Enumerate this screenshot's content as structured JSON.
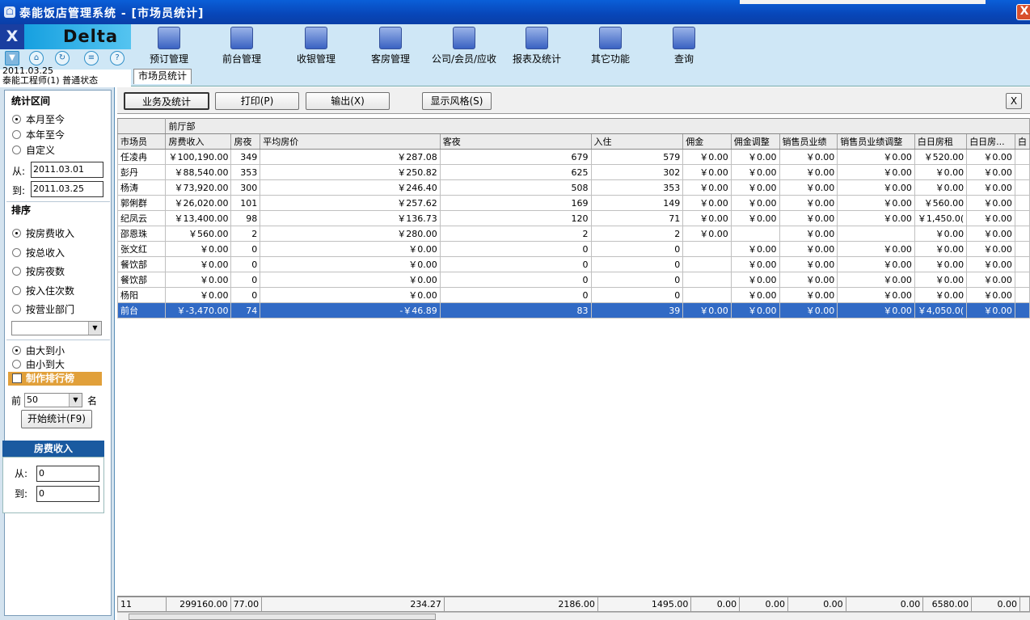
{
  "window": {
    "title": "泰能饭店管理系统 - [市场员统计]",
    "close_glyph": "X"
  },
  "logo": {
    "text": "Delta",
    "close_glyph": "X"
  },
  "toolbar": [
    {
      "label": "预订管理"
    },
    {
      "label": "前台管理"
    },
    {
      "label": "收银管理"
    },
    {
      "label": "客房管理"
    },
    {
      "label": "公司/会员/应收"
    },
    {
      "label": "报表及统计"
    },
    {
      "label": "其它功能"
    },
    {
      "label": "查询"
    }
  ],
  "status": {
    "date": "2011.03.25",
    "user": "泰能工程师(1) 普通状态"
  },
  "tab": {
    "label": "市场员统计"
  },
  "left": {
    "period_title": "统计区间",
    "period_options": [
      "本月至今",
      "本年至今",
      "自定义"
    ],
    "from_label": "从:",
    "from_value": "2011.03.01",
    "to_label": "到:",
    "to_value": "2011.03.25",
    "sort_title": "排序",
    "sort_options": [
      "按房费收入",
      "按总收入",
      "按房夜数",
      "按入住次数",
      "按营业部门"
    ],
    "dept_select": "",
    "order_options": [
      "由大到小",
      "由小到大"
    ],
    "rank_label": "制作排行榜",
    "top_label": "前",
    "top_value": "50",
    "top_suffix": "名",
    "start_button": "开始统计(F9)",
    "fee_title": "房费收入",
    "fee_from_label": "从:",
    "fee_from": "0",
    "fee_to_label": "到:",
    "fee_to": "0"
  },
  "actions": {
    "business": "业务及统计",
    "print": "打印(P)",
    "export": "输出(X)",
    "style": "显示风格(S)",
    "close": "X"
  },
  "grid": {
    "group_header": "前厅部",
    "columns": [
      "市场员",
      "房费收入",
      "房夜",
      "平均房价",
      "客夜",
      "入住",
      "佣金",
      "佣金调整",
      "销售员业绩",
      "销售员业绩调整",
      "白日房租",
      "白日房...",
      "白"
    ],
    "rows": [
      [
        "任凌冉",
        "￥100,190.00",
        "349",
        "￥287.08",
        "679",
        "579",
        "￥0.00",
        "￥0.00",
        "￥0.00",
        "￥0.00",
        "￥520.00",
        "￥0.00",
        ""
      ],
      [
        "彭丹",
        "￥88,540.00",
        "353",
        "￥250.82",
        "625",
        "302",
        "￥0.00",
        "￥0.00",
        "￥0.00",
        "￥0.00",
        "￥0.00",
        "￥0.00",
        ""
      ],
      [
        "杨涛",
        "￥73,920.00",
        "300",
        "￥246.40",
        "508",
        "353",
        "￥0.00",
        "￥0.00",
        "￥0.00",
        "￥0.00",
        "￥0.00",
        "￥0.00",
        ""
      ],
      [
        "郭俐群",
        "￥26,020.00",
        "101",
        "￥257.62",
        "169",
        "149",
        "￥0.00",
        "￥0.00",
        "￥0.00",
        "￥0.00",
        "￥560.00",
        "￥0.00",
        ""
      ],
      [
        "纪凤云",
        "￥13,400.00",
        "98",
        "￥136.73",
        "120",
        "71",
        "￥0.00",
        "￥0.00",
        "￥0.00",
        "￥0.00",
        "￥1,450.0(",
        "￥0.00",
        ""
      ],
      [
        "邵恩珠",
        "￥560.00",
        "2",
        "￥280.00",
        "2",
        "2",
        "￥0.00",
        "",
        "￥0.00",
        "",
        "￥0.00",
        "￥0.00",
        ""
      ],
      [
        "张文红",
        "￥0.00",
        "0",
        "￥0.00",
        "0",
        "0",
        "",
        "￥0.00",
        "￥0.00",
        "￥0.00",
        "￥0.00",
        "￥0.00",
        ""
      ],
      [
        "餐饮部",
        "￥0.00",
        "0",
        "￥0.00",
        "0",
        "0",
        "",
        "￥0.00",
        "￥0.00",
        "￥0.00",
        "￥0.00",
        "￥0.00",
        ""
      ],
      [
        "餐饮部",
        "￥0.00",
        "0",
        "￥0.00",
        "0",
        "0",
        "",
        "￥0.00",
        "￥0.00",
        "￥0.00",
        "￥0.00",
        "￥0.00",
        ""
      ],
      [
        "杨阳",
        "￥0.00",
        "0",
        "￥0.00",
        "0",
        "0",
        "",
        "￥0.00",
        "￥0.00",
        "￥0.00",
        "￥0.00",
        "￥0.00",
        ""
      ],
      [
        "前台",
        "￥-3,470.00",
        "74",
        "-￥46.89",
        "83",
        "39",
        "￥0.00",
        "￥0.00",
        "￥0.00",
        "￥0.00",
        "￥4,050.0(",
        "￥0.00",
        ""
      ]
    ],
    "selected_row": 10,
    "footer": [
      "11",
      "299160.00",
      "77.00",
      "234.27",
      "2186.00",
      "1495.00",
      "0.00",
      "0.00",
      "0.00",
      "0.00",
      "6580.00",
      "0.00",
      ""
    ]
  }
}
